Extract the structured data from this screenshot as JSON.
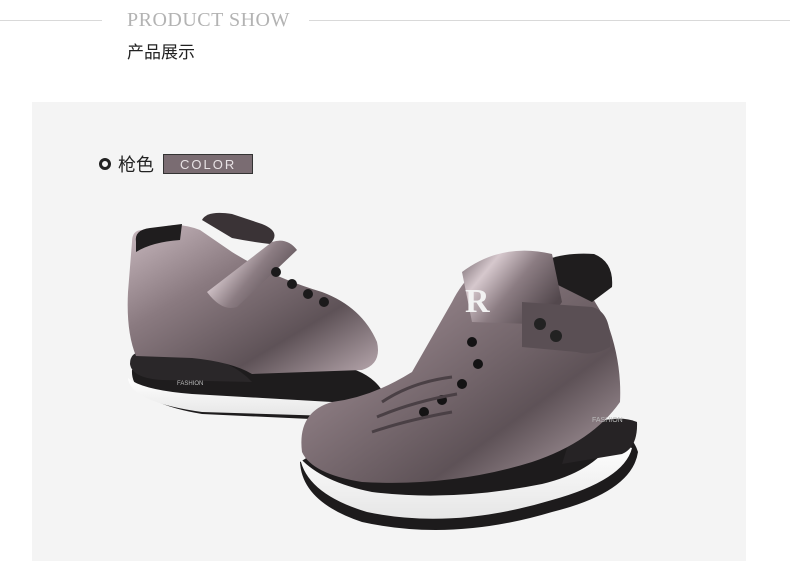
{
  "header": {
    "title_en": "PRODUCT SHOW",
    "title_cn": "产品展示"
  },
  "color_option": {
    "name": "枪色",
    "badge": "COLOR",
    "swatch": "#7a6c72"
  },
  "photo": {
    "subject": "two metallic gunmetal high-top sneakers",
    "logo_letter": "R",
    "brand_text": "FASHION"
  }
}
